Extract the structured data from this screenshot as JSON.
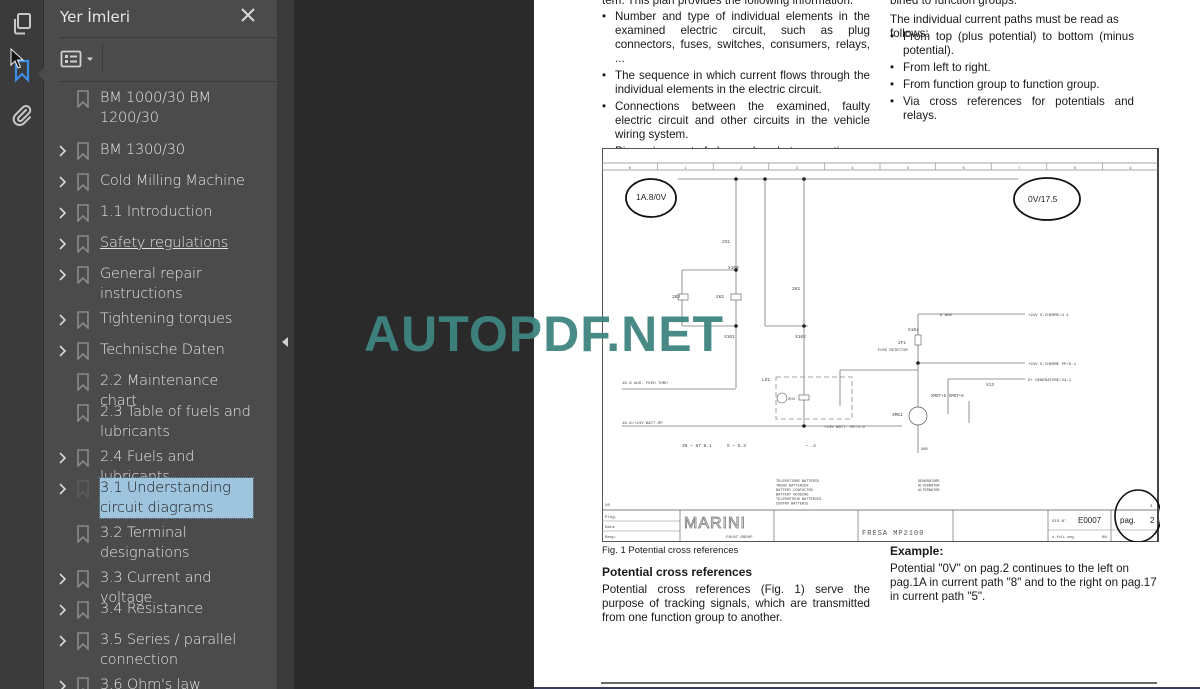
{
  "rail": {
    "icons": [
      {
        "name": "pages-icon",
        "active": false
      },
      {
        "name": "bookmark-icon",
        "active": true
      },
      {
        "name": "attachment-icon",
        "active": false
      }
    ],
    "accent_color": "#3d8ee6"
  },
  "panel": {
    "title": "Yer İmleri",
    "close_label": "close",
    "options_icon": "list-options-icon",
    "bookmarks": [
      {
        "label_lines": [
          "BM 1000/30 BM",
          "1200/30"
        ],
        "expandable": false,
        "selected": false,
        "underline": false
      },
      {
        "label_lines": [
          "BM 1300/30"
        ],
        "expandable": true,
        "selected": false,
        "underline": false
      },
      {
        "label_lines": [
          "Cold Milling Machine"
        ],
        "expandable": true,
        "selected": false,
        "underline": false
      },
      {
        "label_lines": [
          "1.1 Introduction"
        ],
        "expandable": true,
        "selected": false,
        "underline": false
      },
      {
        "label_lines": [
          "Safety regulations"
        ],
        "expandable": true,
        "selected": false,
        "underline": true
      },
      {
        "label_lines": [
          "General repair",
          "instructions"
        ],
        "expandable": true,
        "selected": false,
        "underline": false
      },
      {
        "label_lines": [
          "Tightening torques"
        ],
        "expandable": true,
        "selected": false,
        "underline": false
      },
      {
        "label_lines": [
          "Technische Daten"
        ],
        "expandable": true,
        "selected": false,
        "underline": false
      },
      {
        "label_lines": [
          "2.2 Maintenance chart"
        ],
        "expandable": false,
        "selected": false,
        "underline": false
      },
      {
        "label_lines": [
          "2.3 Table of fuels and",
          "lubricants"
        ],
        "expandable": false,
        "selected": false,
        "underline": false
      },
      {
        "label_lines": [
          "2.4 Fuels and lubricants"
        ],
        "expandable": true,
        "selected": false,
        "underline": false
      },
      {
        "label_lines": [
          "3.1 Understanding",
          "circuit diagrams"
        ],
        "expandable": true,
        "selected": true,
        "underline": false
      },
      {
        "label_lines": [
          "3.2 Terminal",
          "designations"
        ],
        "expandable": false,
        "selected": false,
        "underline": false
      },
      {
        "label_lines": [
          "3.3 Current and voltage"
        ],
        "expandable": true,
        "selected": false,
        "underline": false
      },
      {
        "label_lines": [
          "3.4 Resistance"
        ],
        "expandable": true,
        "selected": false,
        "underline": false
      },
      {
        "label_lines": [
          "3.5 Series / parallel",
          "connection"
        ],
        "expandable": true,
        "selected": false,
        "underline": false
      },
      {
        "label_lines": [
          "3.6 Ohm's law"
        ],
        "expandable": true,
        "selected": false,
        "underline": false
      }
    ],
    "selected_color": "#9fc4de"
  },
  "document": {
    "watermark": "AUTOPDF.NET",
    "left_col": {
      "cut_top": "tem. This plan provides the following information:",
      "bullets": [
        "Number and type of individual elements in the examined electric circuit, such as plug connectors, fuses, switches, consumers, relays, ...",
        "The sequence in which current flows through the individual elements in the electric circuit.",
        "Connections between the examined, faulty electric circuit and other circuits in the vehicle wiring system.",
        "Pin assignment of plug-and-socket connections."
      ]
    },
    "right_col": {
      "cut_top": "bined to function groups.",
      "intro": "The individual current paths must be read as follows:",
      "bullets": [
        "From top (plus potential) to bottom (minus potential).",
        "From left to right.",
        "From function group to function group.",
        "Via cross references for potentials and relays."
      ]
    },
    "diagram": {
      "ruler": [
        "0",
        "1",
        "2",
        "3",
        "4",
        "5",
        "6",
        "7",
        "8",
        "9"
      ],
      "left_ref": "1A.8/0V",
      "right_ref": "0V/17.5",
      "labels": {
        "x100": "X100",
        "x101": "X101",
        "x102": "X102",
        "x104": "X104",
        "x13": "X13",
        "k3": "2K3",
        "k2a": "2K2",
        "k2b": "2K2",
        "s1": "2S1",
        "f1": "2F1",
        "fuse_desc": "FUSE DETECTOR",
        "ld1": "LD1",
        "h1": "2H1",
        "mg1": "3MG1",
        "xmot": "XMOT+5 XMOT+6",
        "cable1": "6 mm2",
        "out1": "+24V S.CHERME/4.1",
        "out2": "+24V S.CHERME PP/8.1",
        "out3": "D+ GENERATORE/24.1",
        "batt_in": "18.6/+24V BATT.RP",
        "batt_out": "+24V BATT. RP/3.6",
        "aux": "18.6 AUX. FEED THRU",
        "relay_note1": "30 ~ 87 6.1",
        "relay_note2": "5 ~ 5.3",
        "relay_note3": "~ .4",
        "batt_legend": [
          "TELERUTTORE BATTERIE",
          "TRENO BATTERIEN",
          "BATTERY CONTACTOR-",
          "BATTERY HOUSING",
          "TELERUPTEUR BATTERIES",
          "CENTRO BATTERIE"
        ],
        "gen_legend": [
          "GENERATORE",
          "ALTERNATOR",
          "ALTERNATOR"
        ],
        "gnd": "GND"
      },
      "title_block": {
        "brand": "MARINI",
        "brand_sub": "FAYAT GROUP",
        "rows": [
          "Prog.",
          "Data",
          "Resp."
        ],
        "title": "FRESA MP2100",
        "dis_label": "DIS.N°",
        "dis_value": "E0007",
        "pag_label": "pag.",
        "pag_value": "2",
        "next_label": "n.foli.seg.",
        "next_value": "08",
        "corner_num": "3",
        "corner_ref": "U8"
      }
    },
    "caption": "Fig. 1 Potential cross references",
    "section_heading": "Potential cross references",
    "section_body": "Potential cross references (Fig. 1) serve the purpose of tracking signals, which are transmitted from one function group to another.",
    "example_heading": "Example:",
    "example_body": "Potential \"0V\" on pag.2 continues to the left on pag.1A in current path \"8\" and to the right on pag.17 in current path \"5\"."
  }
}
